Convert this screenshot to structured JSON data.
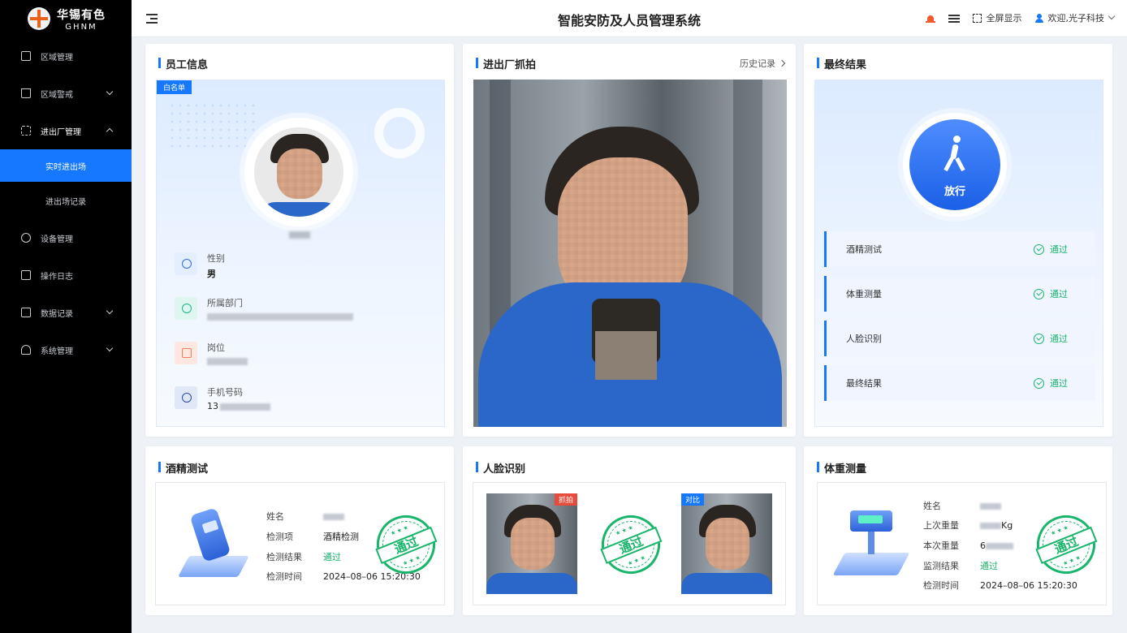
{
  "brand": {
    "cn": "华锡有色",
    "en": "GHNM"
  },
  "header": {
    "title": "智能安防及人员管理系统",
    "fullscreen_label": "全屏显示",
    "user_label": "欢迎,光子科技"
  },
  "sidebar": {
    "items": [
      {
        "label": "区域管理",
        "icon": "map-icon"
      },
      {
        "label": "区域警戒",
        "icon": "warning-icon",
        "expandable": true
      },
      {
        "label": "进出厂管理",
        "icon": "scan-icon",
        "expandable": true,
        "open": true
      },
      {
        "label": "设备管理",
        "icon": "gear-icon"
      },
      {
        "label": "操作日志",
        "icon": "log-icon"
      },
      {
        "label": "数据记录",
        "icon": "chart-icon",
        "expandable": true
      },
      {
        "label": "系统管理",
        "icon": "user-settings-icon",
        "expandable": true
      }
    ],
    "sub_items": [
      {
        "label": "实时进出场",
        "active": true
      },
      {
        "label": "进出场记录",
        "active": false
      }
    ]
  },
  "employee": {
    "title": "员工信息",
    "tag": "白名单",
    "gender_label": "性别",
    "gender_value": "男",
    "dept_label": "所属部门",
    "post_label": "岗位",
    "phone_label": "手机号码",
    "phone_prefix": "13"
  },
  "capture": {
    "title": "进出厂抓拍",
    "history_label": "历史记录"
  },
  "result": {
    "title": "最终结果",
    "pass_label": "放行",
    "checks": [
      {
        "name": "酒精测试",
        "status": "通过"
      },
      {
        "name": "体重测量",
        "status": "通过"
      },
      {
        "name": "人脸识别",
        "status": "通过"
      },
      {
        "name": "最终结果",
        "status": "通过"
      }
    ]
  },
  "alcohol": {
    "title": "酒精测试",
    "name_label": "姓名",
    "item_label": "检测项",
    "item_value": "酒精检测",
    "result_label": "检测结果",
    "result_value": "通过",
    "time_label": "检测时间",
    "time_value": "2024–08–06   15:20:30",
    "stamp": "通过"
  },
  "face": {
    "title": "人脸识别",
    "capture_tag": "抓拍",
    "compare_tag": "对比",
    "stamp": "通过"
  },
  "weight": {
    "title": "体重测量",
    "name_label": "姓名",
    "last_label": "上次重量",
    "last_unit": "Kg",
    "current_label": "本次重量",
    "current_prefix": "6",
    "result_label": "监测结果",
    "result_value": "通过",
    "time_label": "检测时间",
    "time_value": "2024–08–06   15:20:30",
    "stamp": "通过"
  },
  "colors": {
    "accent": "#1677ff",
    "pass": "#18b56a",
    "sidebar": "#000000"
  }
}
